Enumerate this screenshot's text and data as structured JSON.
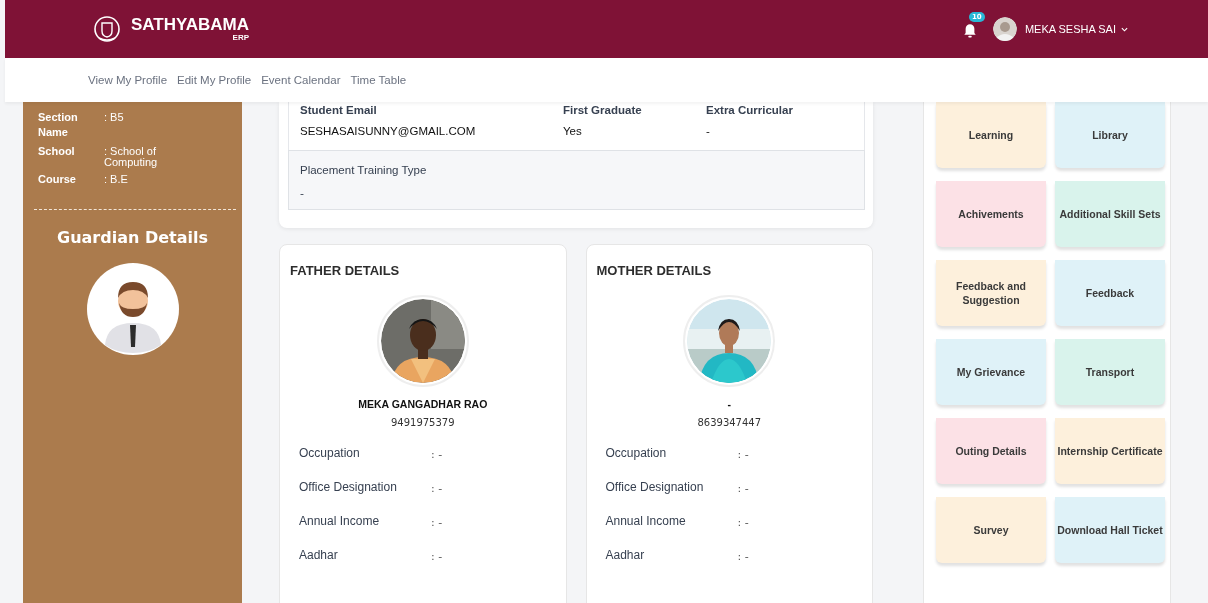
{
  "header": {
    "brand": "SATHYABAMA",
    "brand_sub": "ERP",
    "notification_count": "10",
    "user_name": "MEKA SESHA SAI"
  },
  "nav": [
    "View My Profile",
    "Edit My Profile",
    "Event Calendar",
    "Time Table"
  ],
  "student_panel": {
    "fields": [
      {
        "label": "Section Name",
        "value": ": B5"
      },
      {
        "label": "School",
        "value": ": School of Computing"
      },
      {
        "label": "Course",
        "value": ": B.E"
      }
    ],
    "guardian_title": "Guardian Details"
  },
  "student_card": {
    "fields": [
      {
        "label": "Student Email",
        "value": "SESHASAISUNNY@GMAIL.COM"
      },
      {
        "label": "First Graduate",
        "value": "Yes"
      },
      {
        "label": "Extra Curricular",
        "value": "-"
      }
    ],
    "placement": {
      "label": "Placement Training Type",
      "value": "-"
    }
  },
  "parents": [
    {
      "title": "FATHER DETAILS",
      "name": "MEKA GANGADHAR RAO",
      "phone": "9491975379",
      "fields": [
        {
          "label": "Occupation",
          "value": ": -"
        },
        {
          "label": "Office Designation",
          "value": ": -"
        },
        {
          "label": "Annual Income",
          "value": ": -"
        },
        {
          "label": "Aadhar",
          "value": ": -"
        }
      ]
    },
    {
      "title": "MOTHER DETAILS",
      "name": "-",
      "phone": "8639347447",
      "fields": [
        {
          "label": "Occupation",
          "value": ": -"
        },
        {
          "label": "Office Designation",
          "value": ": -"
        },
        {
          "label": "Annual Income",
          "value": ": -"
        },
        {
          "label": "Aadhar",
          "value": ": -"
        }
      ]
    }
  ],
  "tiles": [
    {
      "label": "Learning",
      "color": "#fdf0dc"
    },
    {
      "label": "Library",
      "color": "#dff2f8"
    },
    {
      "label": "Achivements",
      "color": "#fce1e6"
    },
    {
      "label": "Additional Skill Sets",
      "color": "#d9f3ec"
    },
    {
      "label": "Feedback and Suggestion",
      "color": "#fdf0dc"
    },
    {
      "label": "Feedback",
      "color": "#dff2f8"
    },
    {
      "label": "My Grievance",
      "color": "#dff2f8"
    },
    {
      "label": "Transport",
      "color": "#d9f3ec"
    },
    {
      "label": "Outing Details",
      "color": "#fce1e6"
    },
    {
      "label": "Internship Certificate",
      "color": "#fdf0dc"
    },
    {
      "label": "Survey",
      "color": "#fdf0dc"
    },
    {
      "label": "Download Hall Ticket",
      "color": "#dff2f8"
    }
  ]
}
